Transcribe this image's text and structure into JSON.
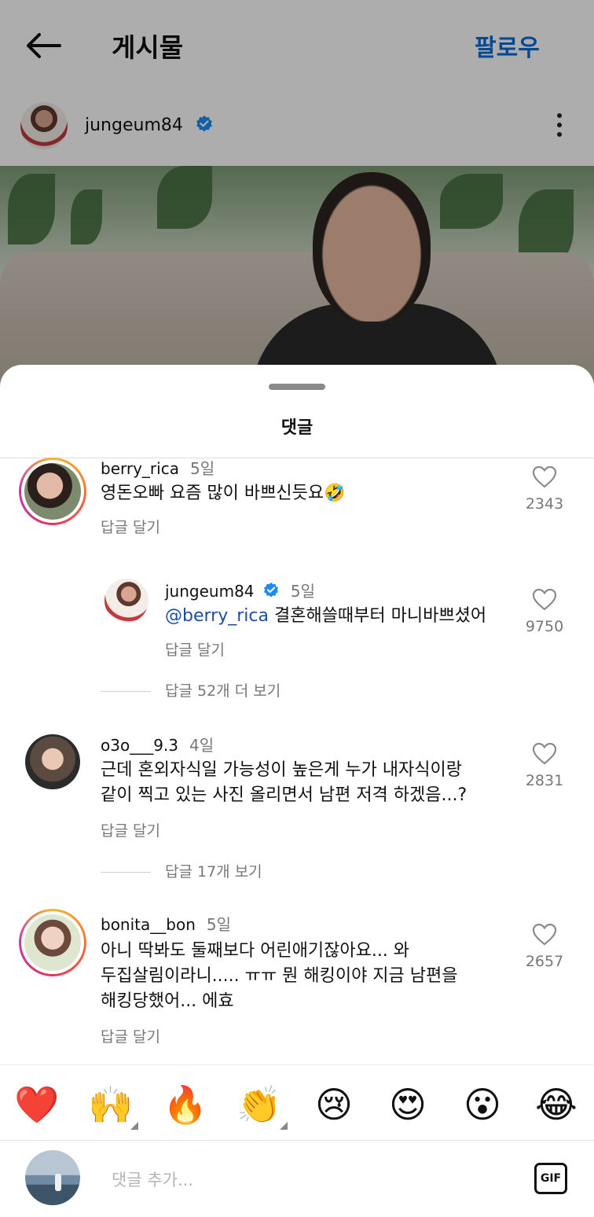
{
  "header": {
    "title": "게시물",
    "follow_label": "팔로우"
  },
  "post": {
    "author": "jungeum84"
  },
  "sheet": {
    "title": "댓글"
  },
  "comments": [
    {
      "user": "berry_rica",
      "time": "5일",
      "text": "영돈오빠 요즘 많이 바쁘신듯요🤣",
      "reply_label": "답글 달기",
      "likes": "2343"
    },
    {
      "user": "jungeum84",
      "time": "5일",
      "mention": "@berry_rica",
      "text": " 결혼해쓸때부터 마니바쁘셨어",
      "reply_label": "답글 달기",
      "likes": "9750",
      "more_replies": "답글 52개 더 보기"
    },
    {
      "user": "o3o___9.3",
      "time": "4일",
      "text_line1": "근데 혼외자식일 가능성이 높은게 누가 내자식이랑",
      "text_line2": "같이 찍고 있는 사진 올리면서 남편 저격 하겠음...?",
      "reply_label": "답글 달기",
      "likes": "2831",
      "more_replies": "답글 17개 보기"
    },
    {
      "user": "bonita__bon",
      "time": "5일",
      "text_line1": "아니 딱봐도 둘째보다 어린애기잖아요... 와",
      "text_line2": "두집살림이라니..... ㅠㅠ 뭔 해킹이야 지금 남편을",
      "text_line3": "해킹당했어... 에효",
      "reply_label": "답글 달기",
      "likes": "2657"
    }
  ],
  "emoji_bar": [
    "❤️",
    "🙌",
    "🔥",
    "👏",
    "😢",
    "😍",
    "😮",
    "😂"
  ],
  "input": {
    "placeholder": "댓글 추가...",
    "gif_label": "GIF"
  },
  "colors": {
    "accent": "#0a6ad6",
    "verified": "#1d8cf0",
    "mention": "#1e4e9a",
    "muted": "#777777"
  }
}
